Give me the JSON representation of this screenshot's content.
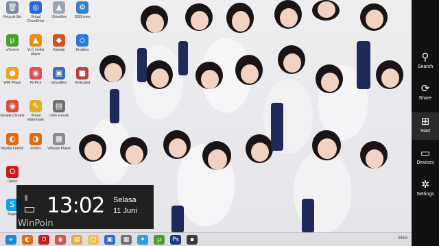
{
  "desktop": {
    "icons": [
      {
        "label": "Recycle Bin",
        "glyph": "🗑",
        "color": "#7a8aa0"
      },
      {
        "label": "Virtual CloneDrive",
        "glyph": "◎",
        "color": "#2a6ad0"
      },
      {
        "label": "IDriveBox",
        "glyph": "▲",
        "color": "#9aa5b5"
      },
      {
        "label": "OSDrivers",
        "glyph": "⚙",
        "color": "#3a80c8"
      },
      {
        "label": "uTorrent",
        "glyph": "µ",
        "color": "#4aa02c"
      },
      {
        "label": "VLC media player",
        "glyph": "▲",
        "color": "#f08a10"
      },
      {
        "label": "Kamaje",
        "glyph": "◆",
        "color": "#d05020"
      },
      {
        "label": "Dropbox",
        "glyph": "◇",
        "color": "#2a7ad8"
      },
      {
        "label": "WMI Player",
        "glyph": "●",
        "color": "#f0a020"
      },
      {
        "label": "PicPick",
        "glyph": "◉",
        "color": "#e05050"
      },
      {
        "label": "VirtualBox",
        "glyph": "▣",
        "color": "#3a6ab8"
      },
      {
        "label": "Dedicated",
        "glyph": "■",
        "color": "#c04040"
      },
      {
        "label": "Google Chrome",
        "glyph": "◉",
        "color": "#dd4b39"
      },
      {
        "label": "Virtual Watermark",
        "glyph": "✎",
        "color": "#e0b020"
      },
      {
        "label": "collin e-book",
        "glyph": "▤",
        "color": "#707070"
      },
      {
        "label": "Mozilla Firefox",
        "glyph": "◐",
        "color": "#e06a10"
      },
      {
        "label": "Firefox",
        "glyph": "◑",
        "color": "#e06a10"
      },
      {
        "label": "VMware Player",
        "glyph": "▦",
        "color": "#8a8a8a"
      },
      {
        "label": "Opera",
        "glyph": "O",
        "color": "#d01818"
      },
      {
        "label": "Skype",
        "glyph": "S",
        "color": "#1aa0e0"
      }
    ]
  },
  "charms": [
    {
      "label": "Search",
      "glyph": "⚲"
    },
    {
      "label": "Share",
      "glyph": "⟳"
    },
    {
      "label": "Start",
      "glyph": "⊞"
    },
    {
      "label": "Devices",
      "glyph": "▭"
    },
    {
      "label": "Settings",
      "glyph": "✲"
    }
  ],
  "clock": {
    "time": "13:02",
    "day": "Selasa",
    "date": "11 Juni"
  },
  "watermark": "WinPoin",
  "taskbar": {
    "items": [
      {
        "name": "internet-explorer",
        "glyph": "e",
        "color": "#1a8ad8"
      },
      {
        "name": "firefox",
        "glyph": "◐",
        "color": "#e06a10"
      },
      {
        "name": "opera",
        "glyph": "O",
        "color": "#d01818"
      },
      {
        "name": "chrome",
        "glyph": "◉",
        "color": "#dd4b39"
      },
      {
        "name": "file-explorer",
        "glyph": "▤",
        "color": "#d8b040"
      },
      {
        "name": "folder",
        "glyph": "▢",
        "color": "#e8c060"
      },
      {
        "name": "app-blue",
        "glyph": "▣",
        "color": "#2a6ad0"
      },
      {
        "name": "app-grey",
        "glyph": "▦",
        "color": "#707070"
      },
      {
        "name": "twitter",
        "glyph": "✦",
        "color": "#2aa0e0"
      },
      {
        "name": "utorrent",
        "glyph": "µ",
        "color": "#4aa02c"
      },
      {
        "name": "photoshop",
        "glyph": "Ps",
        "color": "#1a3a78"
      },
      {
        "name": "app-dark",
        "glyph": "▪",
        "color": "#3a3a3a"
      }
    ],
    "tray_text": "ENG"
  }
}
